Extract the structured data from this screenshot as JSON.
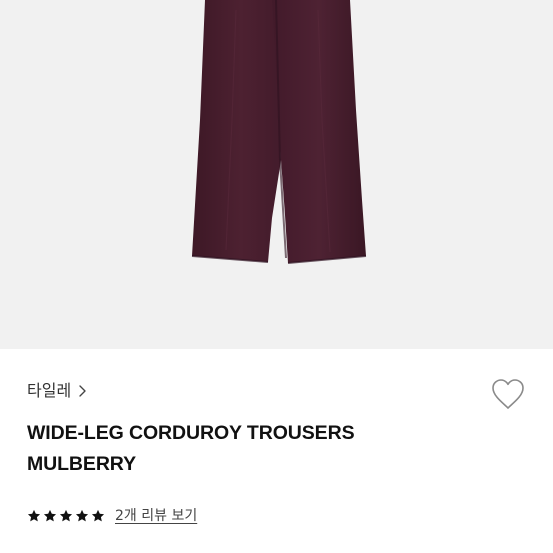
{
  "product": {
    "brand": "타일레",
    "title_line1": "WIDE-LEG CORDUROY TROUSERS",
    "title_line2": "MULBERRY",
    "rating_stars": 5,
    "review_link": "2개 리뷰 보기",
    "trouser_color": "#4a1f2f",
    "image_background": "#f1f1f1"
  },
  "icons": {
    "brand_link": "chevron-right-icon",
    "wishlist": "heart-outline-icon",
    "rating": "star-icon"
  }
}
